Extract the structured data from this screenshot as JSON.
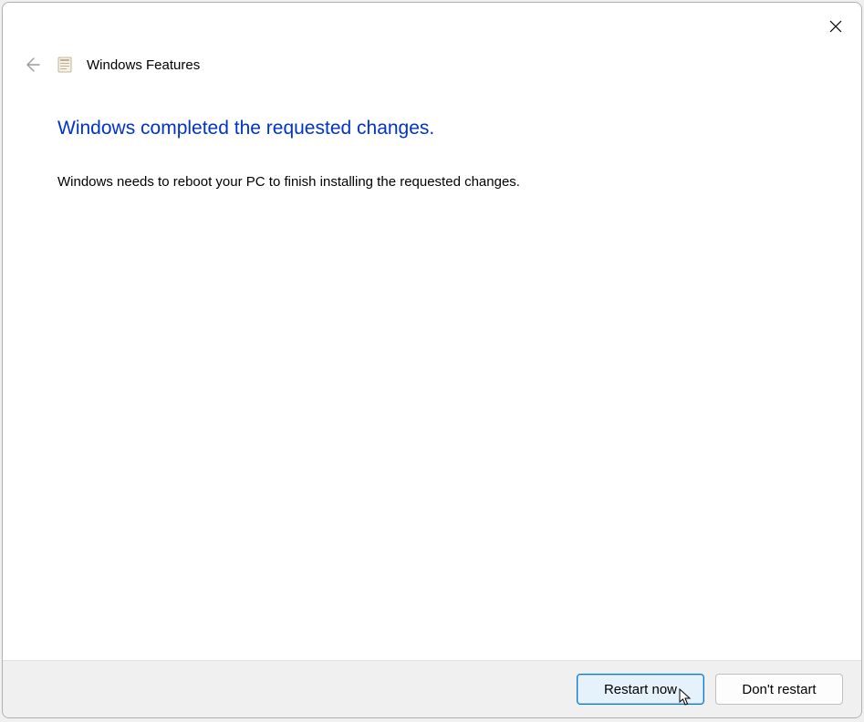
{
  "header": {
    "title": "Windows Features"
  },
  "content": {
    "heading": "Windows completed the requested changes.",
    "body": "Windows needs to reboot your PC to finish installing the requested changes."
  },
  "footer": {
    "primary_label": "Restart now",
    "secondary_label": "Don't restart"
  }
}
